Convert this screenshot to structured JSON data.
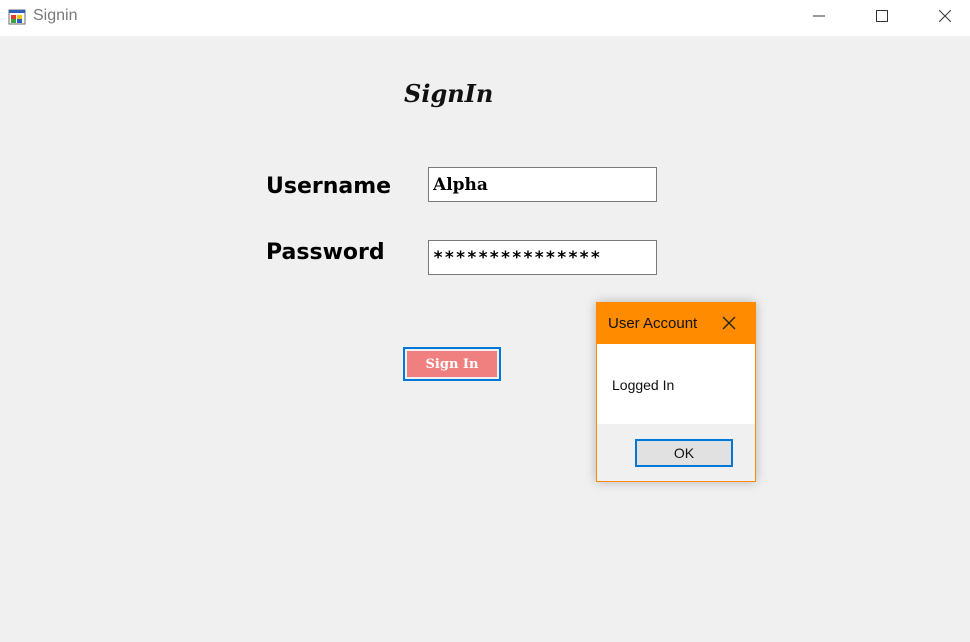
{
  "window": {
    "title": "Signin",
    "icon": "app-window-icon",
    "controls": [
      "minimize-icon",
      "maximize-icon",
      "close-icon"
    ]
  },
  "form": {
    "heading": "SignIn",
    "username_label": "Username",
    "username_value": "Alpha",
    "password_label": "Password",
    "password_value": "***************",
    "signin_button": "Sign In"
  },
  "dialog": {
    "title": "User Account",
    "message": "Logged In",
    "ok_label": "OK",
    "accent_color": "#ff8c00"
  },
  "colors": {
    "signin_button_bg": "#f08080",
    "focus_border": "#0078d7",
    "background": "#f0f0f0"
  }
}
